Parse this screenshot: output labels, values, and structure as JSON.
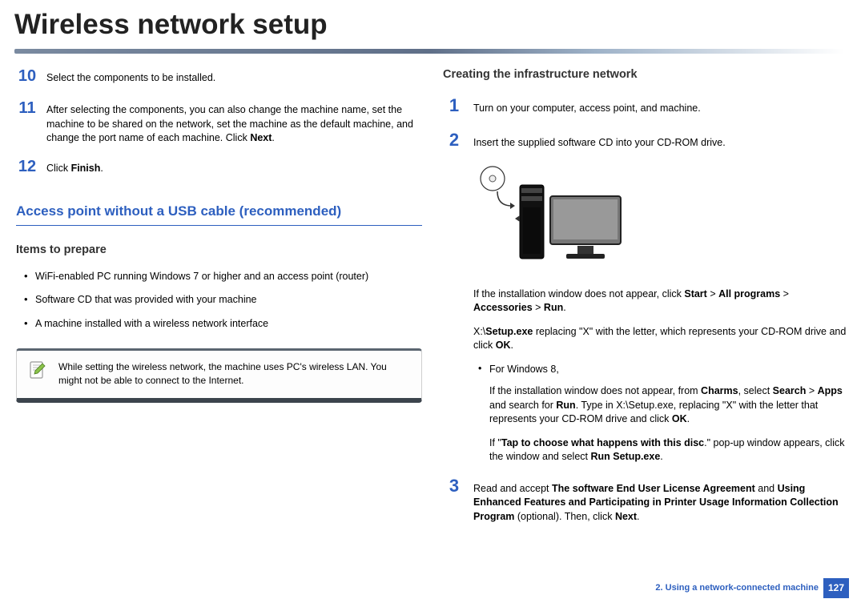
{
  "page_title": "Wireless network setup",
  "left": {
    "steps": [
      {
        "num": "10",
        "html": "Select the components to be installed."
      },
      {
        "num": "11",
        "html": "After selecting the components, you can also change the machine name, set the machine to be shared on the network, set the machine as the default machine, and change the port name of each machine. Click <b>Next</b>."
      },
      {
        "num": "12",
        "html": "Click <b>Finish</b>."
      }
    ],
    "heading_large": "Access point without a USB cable (recommended)",
    "heading_mid": "Items to prepare",
    "items": [
      "WiFi-enabled PC running Windows 7 or higher and an access point (router)",
      "Software CD that was provided with your machine",
      "A machine installed with a wireless network interface"
    ],
    "note": "While setting the wireless network, the machine uses PC's wireless LAN. You might not be able to connect to the Internet."
  },
  "right": {
    "heading_mid": "Creating the infrastructure network",
    "steps_top": [
      {
        "num": "1",
        "html": "Turn on your computer, access point, and machine."
      },
      {
        "num": "2",
        "html": "Insert the supplied software CD into your CD-ROM drive."
      }
    ],
    "block_after_illustration": [
      {
        "type": "p",
        "html": "If the installation window does not appear, click <b>Start</b> > <b>All programs</b> > <b>Accessories</b> > <b>Run</b>."
      },
      {
        "type": "p",
        "html": " X:\\<b>Setup.exe</b> replacing \"X\" with the letter, which represents your CD-ROM drive and click <b>OK</b>."
      },
      {
        "type": "li",
        "html": "For Windows 8,"
      },
      {
        "type": "p_indent",
        "html": "If the installation window does not appear, from <b>Charms</b>, select <b>Search</b> > <b>Apps</b> and search for <b>Run</b>. Type in X:\\Setup.exe, replacing \"X\" with the letter that represents your CD-ROM drive and click <b>OK</b>."
      },
      {
        "type": "p_indent",
        "html": "If \"<b>Tap to choose what happens with this disc</b>.\" pop-up window appears, click the window and select <b>Run Setup.exe</b>."
      }
    ],
    "step3": {
      "num": "3",
      "html": "Read and accept <b>The software End User License Agreement</b>  and <b>Using Enhanced Features and Participating in Printer Usage Information Collection Program</b> (optional). Then, click <b>Next</b>."
    }
  },
  "footer": {
    "chapter": "2.  Using a network-connected machine",
    "page": "127"
  }
}
